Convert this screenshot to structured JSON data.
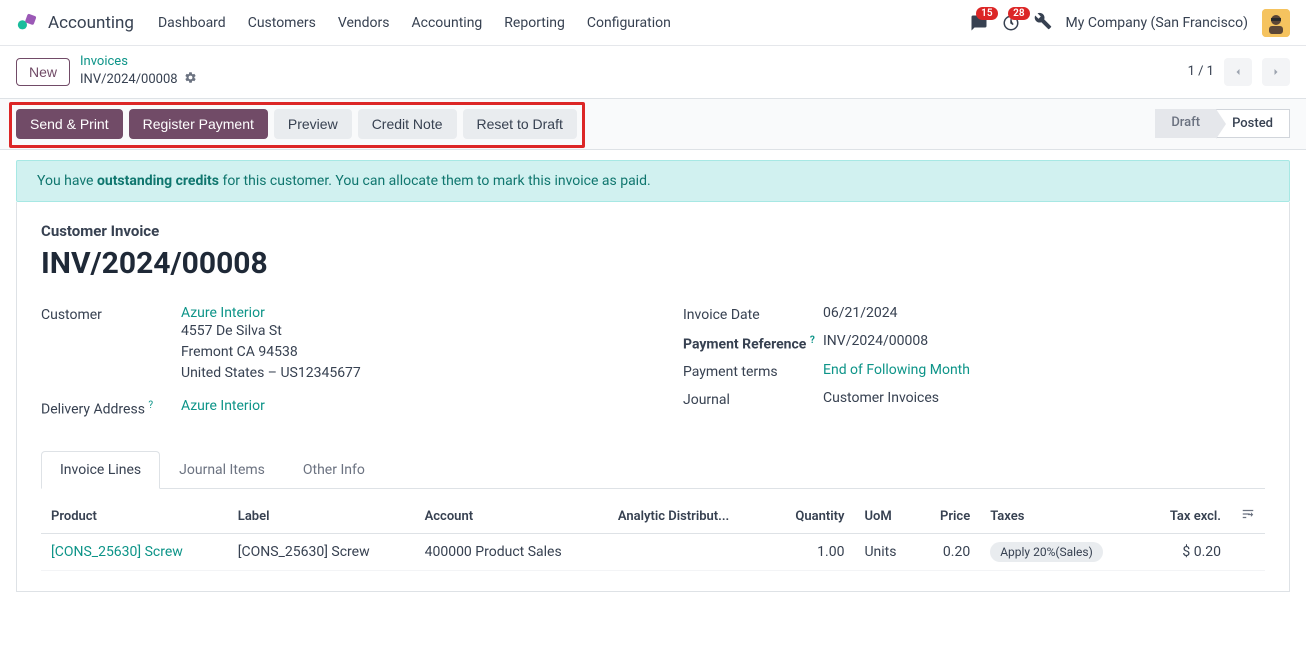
{
  "topnav": {
    "app": "Accounting",
    "items": [
      "Dashboard",
      "Customers",
      "Vendors",
      "Accounting",
      "Reporting",
      "Configuration"
    ],
    "messages_badge": "15",
    "activities_badge": "28",
    "company": "My Company (San Francisco)"
  },
  "cp": {
    "new_btn": "New",
    "breadcrumb_top": "Invoices",
    "breadcrumb_current": "INV/2024/00008",
    "pager": "1 / 1"
  },
  "statusbar": {
    "buttons": [
      "Send & Print",
      "Register Payment",
      "Preview",
      "Credit Note",
      "Reset to Draft"
    ],
    "button_styles": [
      "primary",
      "primary",
      "secondary",
      "secondary",
      "secondary"
    ],
    "statuses": [
      "Draft",
      "Posted"
    ]
  },
  "banner": {
    "prefix": "You have ",
    "bold": "outstanding credits",
    "suffix": " for this customer. You can allocate them to mark this invoice as paid."
  },
  "sheet": {
    "header": "Customer Invoice",
    "title": "INV/2024/00008",
    "left": {
      "customer_label": "Customer",
      "customer_name": "Azure Interior",
      "addr1": "4557 De Silva St",
      "addr2": "Fremont CA 94538",
      "addr3": "United States – US12345677",
      "delivery_label": "Delivery Address",
      "delivery_value": "Azure Interior"
    },
    "right": {
      "date_label": "Invoice Date",
      "date_value": "06/21/2024",
      "ref_label": "Payment Reference",
      "ref_value": "INV/2024/00008",
      "terms_label": "Payment terms",
      "terms_value": "End of Following Month",
      "journal_label": "Journal",
      "journal_value": "Customer Invoices"
    }
  },
  "tabs": [
    "Invoice Lines",
    "Journal Items",
    "Other Info"
  ],
  "table": {
    "headers": [
      "Product",
      "Label",
      "Account",
      "Analytic Distribut...",
      "Quantity",
      "UoM",
      "Price",
      "Taxes",
      "Tax excl."
    ],
    "row": {
      "product": "[CONS_25630] Screw",
      "label": "[CONS_25630] Screw",
      "account": "400000 Product Sales",
      "analytic": "",
      "qty": "1.00",
      "uom": "Units",
      "price": "0.20",
      "taxes": "Apply 20%(Sales)",
      "tax_excl": "$ 0.20"
    }
  }
}
